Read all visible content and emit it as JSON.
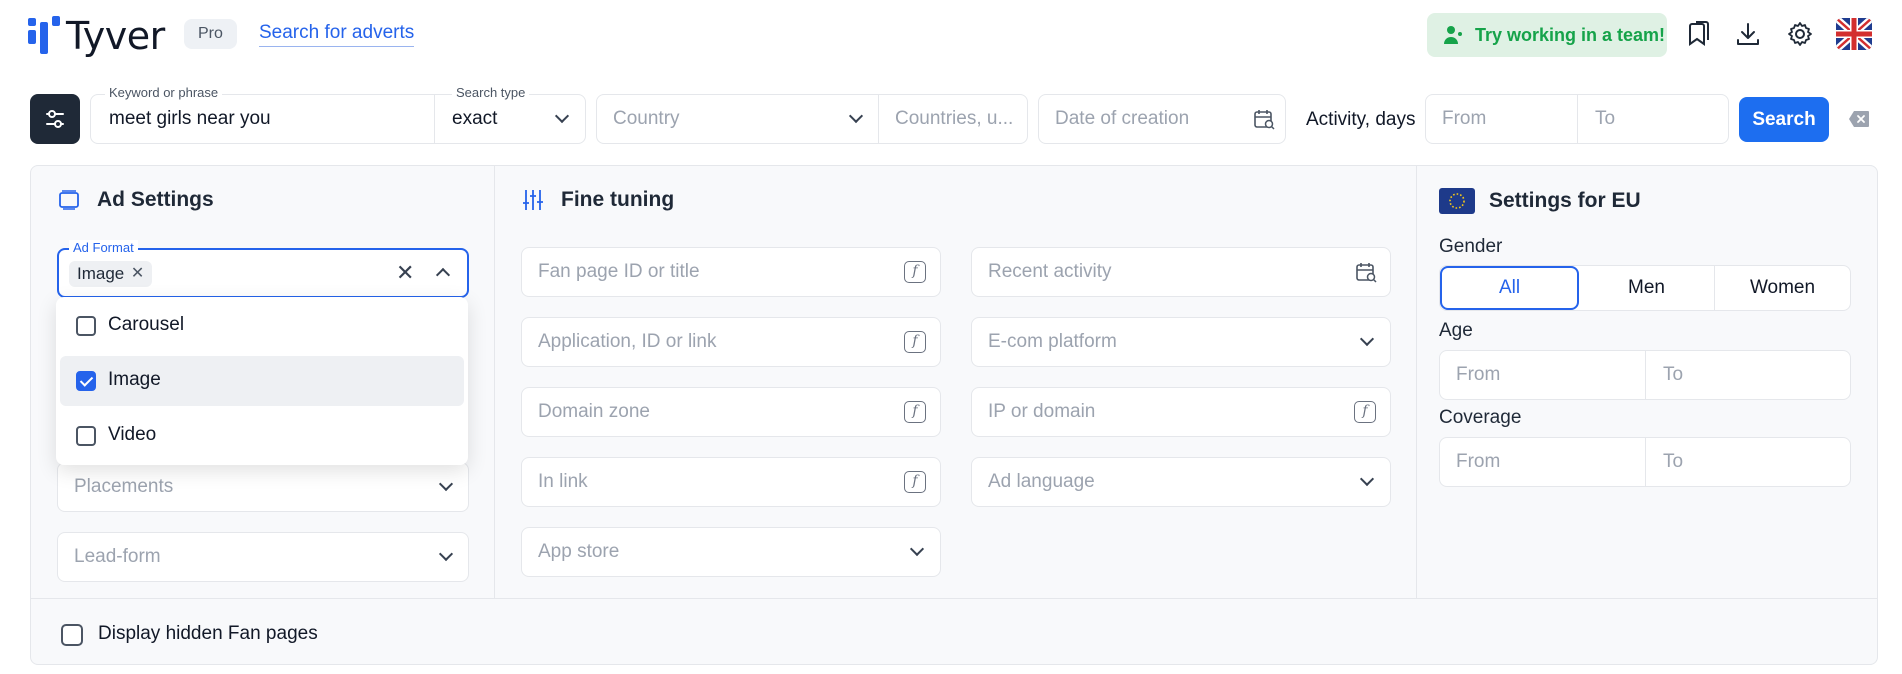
{
  "header": {
    "logo_text": "Tyver",
    "pro_badge": "Pro",
    "search_adverts_link": "Search for adverts",
    "team_button": "Try working in a team!"
  },
  "search": {
    "keyword_label": "Keyword or phrase",
    "keyword_value": "meet girls near you",
    "search_type_label": "Search type",
    "search_type_value": "exact",
    "country_placeholder": "Country",
    "countries_placeholder": "Countries, u...",
    "date_placeholder": "Date of creation",
    "activity_label": "Activity, days",
    "activity_from": "From",
    "activity_to": "To",
    "search_button": "Search"
  },
  "ad_settings": {
    "title": "Ad Settings",
    "ad_format_label": "Ad Format",
    "ad_format_chip": "Image",
    "ad_format_options": [
      {
        "label": "Carousel",
        "checked": false
      },
      {
        "label": "Image",
        "checked": true
      },
      {
        "label": "Video",
        "checked": false
      }
    ],
    "placements_placeholder": "Placements",
    "leadform_placeholder": "Lead-form"
  },
  "fine_tuning": {
    "title": "Fine tuning",
    "fanpage_placeholder": "Fan page ID or title",
    "recent_activity_placeholder": "Recent activity",
    "application_placeholder": "Application, ID or link",
    "ecom_placeholder": "E-com platform",
    "domain_zone_placeholder": "Domain zone",
    "ip_domain_placeholder": "IP or domain",
    "in_link_placeholder": "In link",
    "ad_language_placeholder": "Ad language",
    "app_store_placeholder": "App store"
  },
  "eu_settings": {
    "title": "Settings for EU",
    "gender_label": "Gender",
    "gender_options": [
      "All",
      "Men",
      "Women"
    ],
    "gender_selected": "All",
    "age_label": "Age",
    "age_from": "From",
    "age_to": "To",
    "coverage_label": "Coverage",
    "coverage_from": "From",
    "coverage_to": "To"
  },
  "footer": {
    "hidden_fanpages_label": "Display hidden Fan pages"
  },
  "colors": {
    "accent": "#2563eb",
    "team_green": "#16a34a",
    "team_bg": "#dff1e4",
    "dark_button": "#1f2937"
  }
}
